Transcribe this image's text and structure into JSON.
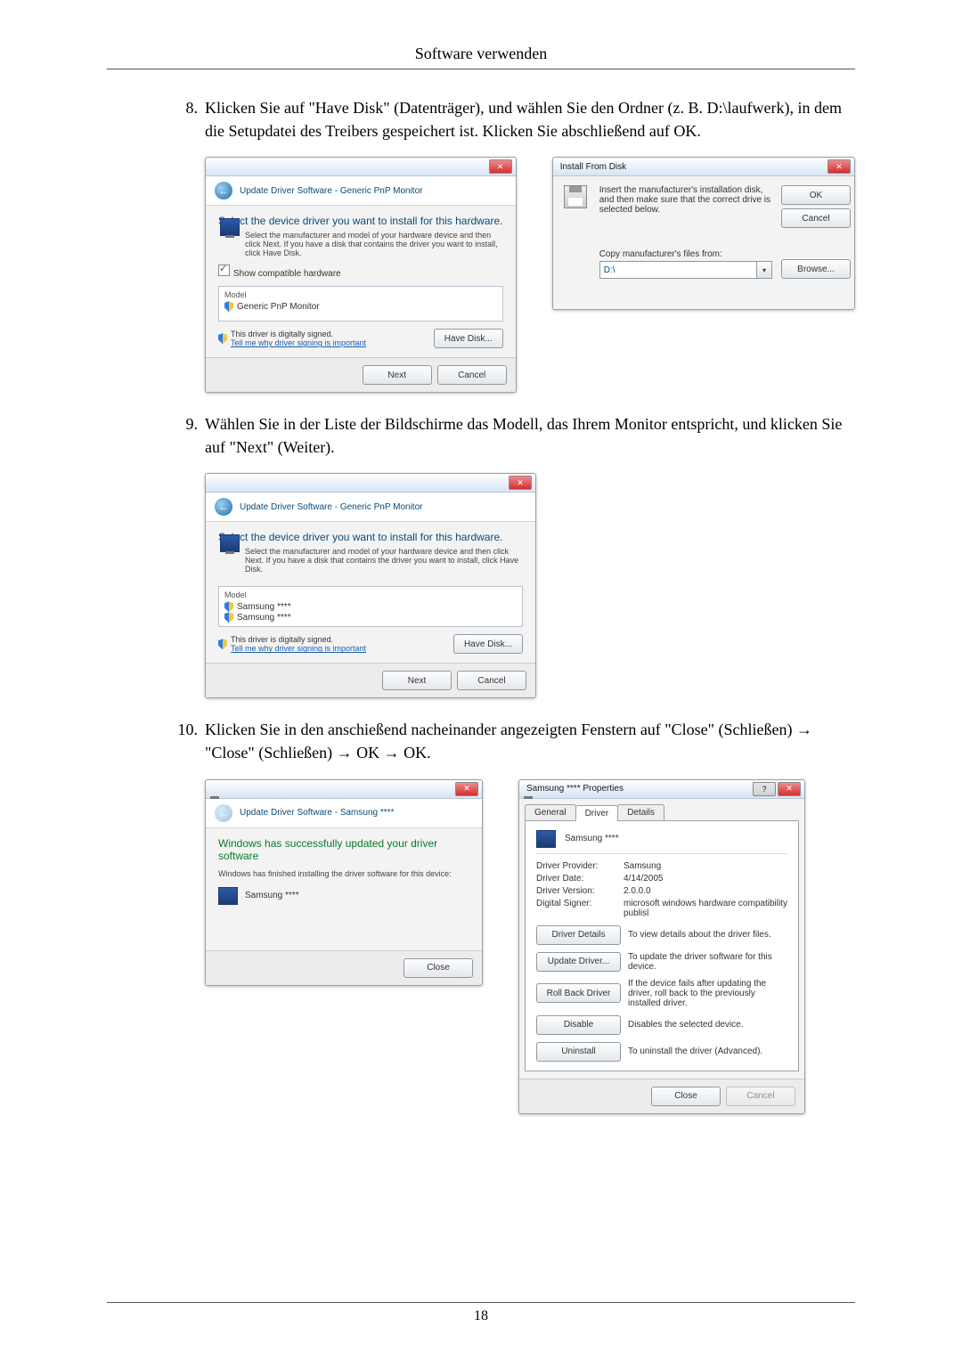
{
  "doc": {
    "section_title": "Software verwenden",
    "page_number": "18",
    "steps": {
      "s8": {
        "num": "8.",
        "text": "Klicken Sie auf \"Have Disk\" (Datenträger), und wählen Sie den Ordner (z. B. D:\\laufwerk), in dem die Setupdatei des Treibers gespeichert ist. Klicken Sie abschließend auf OK."
      },
      "s9": {
        "num": "9.",
        "text": "Wählen Sie in der Liste der Bildschirme das Modell, das Ihrem Monitor entspricht, und klicken Sie auf \"Next\" (Weiter)."
      },
      "s10": {
        "num": "10.",
        "text": "Klicken Sie in den anschießend nacheinander angezeigten Fenstern auf \"Close\" (Schließen) → \"Close\" (Schließen) → OK → OK."
      }
    }
  },
  "dlg_select1": {
    "titlebar": "",
    "breadcrumb": "Update Driver Software - Generic PnP Monitor",
    "heading": "Select the device driver you want to install for this hardware.",
    "desc": "Select the manufacturer and model of your hardware device and then click Next. If you have a disk that contains the driver you want to install, click Have Disk.",
    "show_compat": "Show compatible hardware",
    "list_hdr": "Model",
    "list_item": "Generic PnP Monitor",
    "signed": "This driver is digitally signed.",
    "signed_link": "Tell me why driver signing is important",
    "have_disk": "Have Disk...",
    "next": "Next",
    "cancel": "Cancel"
  },
  "dlg_install": {
    "titlebar": "Install From Disk",
    "desc": "Insert the manufacturer's installation disk, and then make sure that the correct drive is selected below.",
    "ok": "OK",
    "cancel": "Cancel",
    "copy_label": "Copy manufacturer's files from:",
    "path": "D:\\",
    "browse": "Browse..."
  },
  "dlg_select2": {
    "breadcrumb": "Update Driver Software - Generic PnP Monitor",
    "heading": "Select the device driver you want to install for this hardware.",
    "desc": "Select the manufacturer and model of your hardware device and then click Next. If you have a disk that contains the driver you want to install, click Have Disk.",
    "list_hdr": "Model",
    "list_item1": "Samsung ****",
    "list_item2": "Samsung ****",
    "signed": "This driver is digitally signed.",
    "signed_link": "Tell me why driver signing is important",
    "have_disk": "Have Disk...",
    "next": "Next",
    "cancel": "Cancel"
  },
  "dlg_done": {
    "breadcrumb": "Update Driver Software - Samsung ****",
    "heading": "Windows has successfully updated your driver software",
    "desc": "Windows has finished installing the driver software for this device:",
    "device": "Samsung ****",
    "close": "Close"
  },
  "dlg_props": {
    "titlebar": "Samsung **** Properties",
    "tabs": {
      "general": "General",
      "driver": "Driver",
      "details": "Details"
    },
    "device_name": "Samsung ****",
    "provider_lbl": "Driver Provider:",
    "provider": "Samsung",
    "date_lbl": "Driver Date:",
    "date": "4/14/2005",
    "ver_lbl": "Driver Version:",
    "ver": "2.0.0.0",
    "signer_lbl": "Digital Signer:",
    "signer": "microsoft windows hardware compatibility publisl",
    "btn_details": "Driver Details",
    "btn_details_desc": "To view details about the driver files.",
    "btn_update": "Update Driver...",
    "btn_update_desc": "To update the driver software for this device.",
    "btn_rollback": "Roll Back Driver",
    "btn_rollback_desc": "If the device fails after updating the driver, roll back to the previously installed driver.",
    "btn_disable": "Disable",
    "btn_disable_desc": "Disables the selected device.",
    "btn_uninstall": "Uninstall",
    "btn_uninstall_desc": "To uninstall the driver (Advanced).",
    "close": "Close",
    "cancel": "Cancel"
  }
}
